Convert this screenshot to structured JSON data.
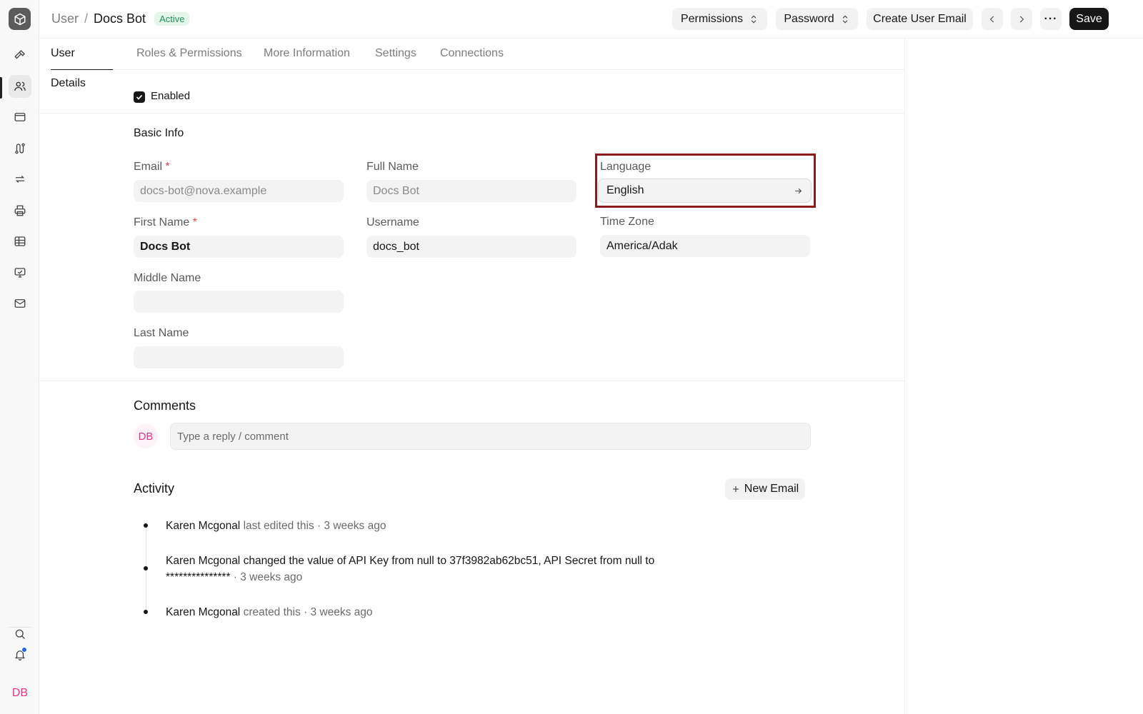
{
  "header": {
    "breadcrumb_parent": "User",
    "breadcrumb_sep": "/",
    "breadcrumb_current": "Docs Bot",
    "status_badge": "Active",
    "permissions_label": "Permissions",
    "password_label": "Password",
    "create_email_label": "Create User Email",
    "more_label": "···",
    "save_label": "Save"
  },
  "tabs": [
    {
      "label": "User Details"
    },
    {
      "label": "Roles & Permissions"
    },
    {
      "label": "More Information"
    },
    {
      "label": "Settings"
    },
    {
      "label": "Connections"
    }
  ],
  "sidebar": {
    "icons": [
      "hammer-icon",
      "users-icon",
      "browser-icon",
      "route-icon",
      "sync-icon",
      "printer-icon",
      "table-icon",
      "monitor-icon",
      "mail-icon"
    ],
    "bottom": {
      "avatar_initials": "DB"
    }
  },
  "form": {
    "enabled_label": "Enabled",
    "enabled_checked": true,
    "section_title": "Basic Info",
    "email": {
      "label": "Email",
      "required_mark": "*",
      "value": "docs-bot@nova.example"
    },
    "full_name": {
      "label": "Full Name",
      "value": "Docs Bot"
    },
    "language": {
      "label": "Language",
      "value": "English"
    },
    "first_name": {
      "label": "First Name",
      "required_mark": "*",
      "value": "Docs Bot"
    },
    "username": {
      "label": "Username",
      "value": "docs_bot"
    },
    "time_zone": {
      "label": "Time Zone",
      "value": "America/Adak"
    },
    "middle_name": {
      "label": "Middle Name",
      "value": ""
    },
    "last_name": {
      "label": "Last Name",
      "value": ""
    }
  },
  "comments": {
    "title": "Comments",
    "avatar_initials": "DB",
    "placeholder": "Type a reply / comment"
  },
  "activity": {
    "title": "Activity",
    "new_email_label": "New Email",
    "items": [
      {
        "actor": "Karen Mcgonal",
        "text": " last edited this · 3 weeks ago"
      },
      {
        "actor": "Karen Mcgonal",
        "t1": " changed the value of API Key from ",
        "v1": "null",
        "t2": " to ",
        "v2": "37f3982ab62bc51",
        "t3": ", API Secret from ",
        "v3": "null",
        "t4": " to",
        "v4": "***************",
        "t5": " · 3 weeks ago"
      },
      {
        "actor": "Karen Mcgonal",
        "text": " created this · 3 weeks ago"
      }
    ]
  },
  "colors": {
    "accent": "#171717",
    "badge_bg": "#e4f5e9",
    "badge_text": "#278f5e",
    "highlight_border": "#8b1c1c",
    "avatar_pink": "#e0368c"
  }
}
